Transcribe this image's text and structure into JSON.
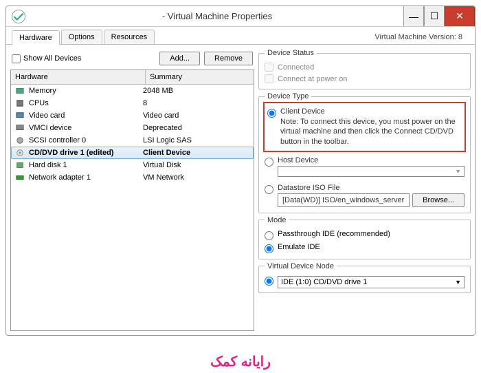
{
  "window": {
    "title": "- Virtual Machine Properties",
    "version_label": "Virtual Machine Version: 8"
  },
  "tabs": {
    "hardware": "Hardware",
    "options": "Options",
    "resources": "Resources"
  },
  "toolbar": {
    "show_all": "Show All Devices",
    "add": "Add...",
    "remove": "Remove"
  },
  "columns": {
    "hardware": "Hardware",
    "summary": "Summary"
  },
  "hardware": [
    {
      "name": "Memory",
      "summary": "2048 MB"
    },
    {
      "name": "CPUs",
      "summary": "8"
    },
    {
      "name": "Video card",
      "summary": "Video card"
    },
    {
      "name": "VMCI device",
      "summary": "Deprecated"
    },
    {
      "name": "SCSI controller 0",
      "summary": "LSI Logic SAS"
    },
    {
      "name": "CD/DVD drive 1 (edited)",
      "summary": "Client Device"
    },
    {
      "name": "Hard disk 1",
      "summary": "Virtual Disk"
    },
    {
      "name": "Network adapter 1",
      "summary": "VM Network"
    }
  ],
  "device_status": {
    "legend": "Device Status",
    "connected": "Connected",
    "connect_power_on": "Connect at power on"
  },
  "device_type": {
    "legend": "Device Type",
    "client": "Client Device",
    "client_note": "Note: To connect this device, you must power on the virtual machine and then click the Connect CD/DVD button in the toolbar.",
    "host": "Host Device",
    "host_value": "",
    "datastore": "Datastore ISO File",
    "iso_path": "[Data(WD)] ISO/en_windows_server",
    "browse": "Browse..."
  },
  "mode": {
    "legend": "Mode",
    "passthrough": "Passthrough IDE (recommended)",
    "emulate": "Emulate IDE"
  },
  "vdn": {
    "legend": "Virtual Device Node",
    "value": "IDE (1:0) CD/DVD drive 1"
  },
  "footer": "رایانه کمک"
}
